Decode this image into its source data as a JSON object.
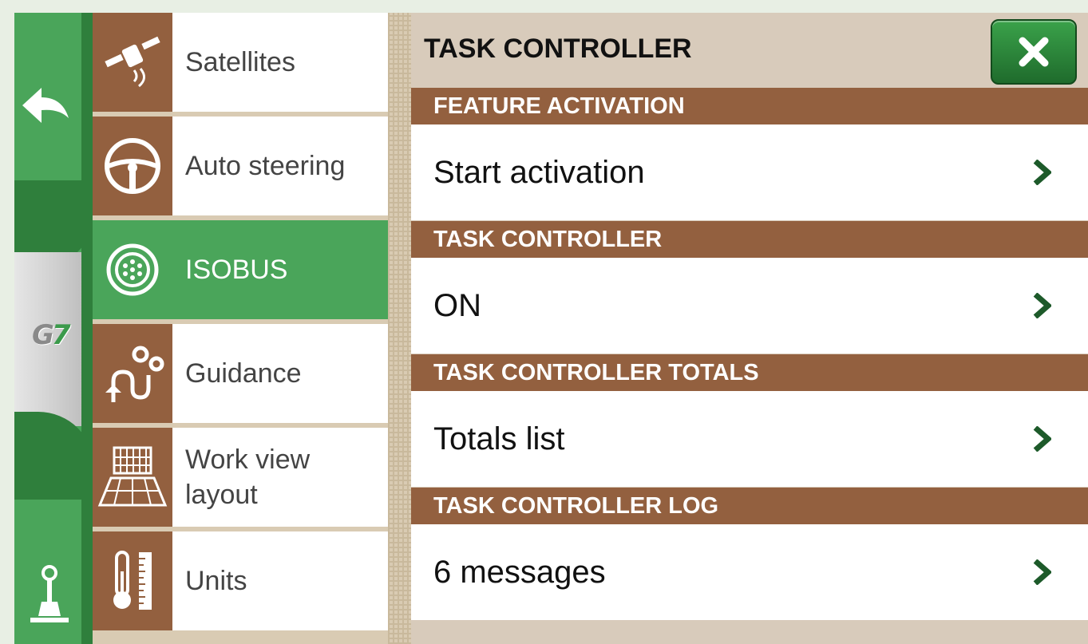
{
  "colors": {
    "green": "#4aa55a",
    "dark_green": "#2f7f3c",
    "brown": "#93603f",
    "beige": "#d8cbbb"
  },
  "rail": {
    "back_icon": "back-arrow-icon",
    "logo_g": "G",
    "logo_7": "7",
    "joystick_icon": "joystick-icon"
  },
  "menu": {
    "items": [
      {
        "label": "Satellites",
        "icon": "satellite-icon"
      },
      {
        "label": "Auto steering",
        "icon": "steering-wheel-icon"
      },
      {
        "label": "ISOBUS",
        "icon": "isobus-connector-icon",
        "active": true
      },
      {
        "label": "Guidance",
        "icon": "guidance-gears-icon"
      },
      {
        "label": "Work view layout",
        "icon": "work-view-layout-icon"
      },
      {
        "label": "Units",
        "icon": "units-thermometer-ruler-icon"
      }
    ]
  },
  "panel": {
    "title": "TASK CONTROLLER",
    "close_icon": "close-icon",
    "sections": [
      {
        "header": "FEATURE ACTIVATION",
        "value": "Start activation"
      },
      {
        "header": "TASK CONTROLLER",
        "value": "ON"
      },
      {
        "header": "TASK CONTROLLER TOTALS",
        "value": "Totals list"
      },
      {
        "header": "TASK CONTROLLER LOG",
        "value": "6 messages"
      }
    ]
  }
}
